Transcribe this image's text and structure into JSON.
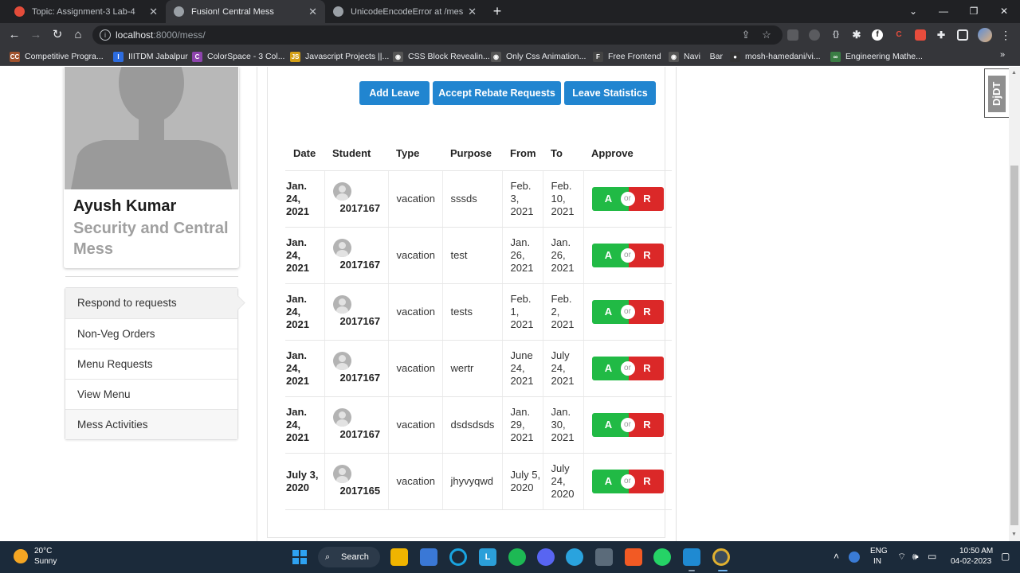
{
  "browser": {
    "tabs": [
      {
        "title": "Topic: Assignment-3 Lab-4",
        "favicon_color": "#e34c3a"
      },
      {
        "title": "Fusion! Central Mess",
        "favicon_color": "#9aa0a6"
      },
      {
        "title": "UnicodeEncodeError at /mess/m",
        "favicon_color": "#9aa0a6"
      }
    ],
    "url_host": "localhost",
    "url_rest": ":8000/mess/",
    "bookmarks": [
      {
        "label": "Competitive Progra...",
        "icon": "CC",
        "color": "#a0522d"
      },
      {
        "label": "IIITDM Jabalpur",
        "icon": "I",
        "color": "#2d6cdf"
      },
      {
        "label": "ColorSpace - 3 Col...",
        "icon": "C",
        "color": "#8e44ad"
      },
      {
        "label": "Javascript Projects ||...",
        "icon": "JS",
        "color": "#d4a017"
      },
      {
        "label": "CSS Block Revealin...",
        "icon": "◉",
        "color": "#555555"
      },
      {
        "label": "Only Css Animation...",
        "icon": "◉",
        "color": "#555555"
      },
      {
        "label": "Free Frontend",
        "icon": "F",
        "color": "#444444"
      },
      {
        "label": "Navi    Bar",
        "icon": "◉",
        "color": "#555555"
      },
      {
        "label": "mosh-hamedani/vi...",
        "icon": "●",
        "color": "#333333"
      },
      {
        "label": "Engineering Mathe...",
        "icon": "∞",
        "color": "#3a7d44"
      }
    ]
  },
  "profile": {
    "name": "Ayush Kumar",
    "role": "Security and Central Mess"
  },
  "menu": [
    "Respond to requests",
    "Non-Veg Orders",
    "Menu Requests",
    "View Menu",
    "Mess Activities"
  ],
  "actions": {
    "add_leave": "Add Leave",
    "accept_rebate": "Accept Rebate Requests",
    "leave_stats": "Leave Statistics"
  },
  "table": {
    "headers": [
      "Date",
      "Student",
      "Type",
      "Purpose",
      "From",
      "To",
      "Approve"
    ],
    "approve_label": "A",
    "or_label": "or",
    "reject_label": "R",
    "rows": [
      {
        "date": "Jan. 24, 2021",
        "student": "2017167",
        "type": "vacation",
        "purpose": "sssds",
        "from": "Feb. 3, 2021",
        "to": "Feb. 10, 2021"
      },
      {
        "date": "Jan. 24, 2021",
        "student": "2017167",
        "type": "vacation",
        "purpose": "test",
        "from": "Jan. 26, 2021",
        "to": "Jan. 26, 2021"
      },
      {
        "date": "Jan. 24, 2021",
        "student": "2017167",
        "type": "vacation",
        "purpose": "tests",
        "from": "Feb. 1, 2021",
        "to": "Feb. 2, 2021"
      },
      {
        "date": "Jan. 24, 2021",
        "student": "2017167",
        "type": "vacation",
        "purpose": "wertr",
        "from": "June 24, 2021",
        "to": "July 24, 2021"
      },
      {
        "date": "Jan. 24, 2021",
        "student": "2017167",
        "type": "vacation",
        "purpose": "dsdsdsds",
        "from": "Jan. 29, 2021",
        "to": "Jan. 30, 2021"
      },
      {
        "date": "July 3, 2020",
        "student": "2017165",
        "type": "vacation",
        "purpose": "jhyvyqwd",
        "from": "July 5, 2020",
        "to": "July 24, 2020"
      }
    ]
  },
  "djdt_label": "DjDT",
  "taskbar": {
    "temp": "20°C",
    "weather": "Sunny",
    "search": "Search",
    "lang": "ENG",
    "region": "IN",
    "time": "10:50 AM",
    "date": "04-02-2023"
  }
}
